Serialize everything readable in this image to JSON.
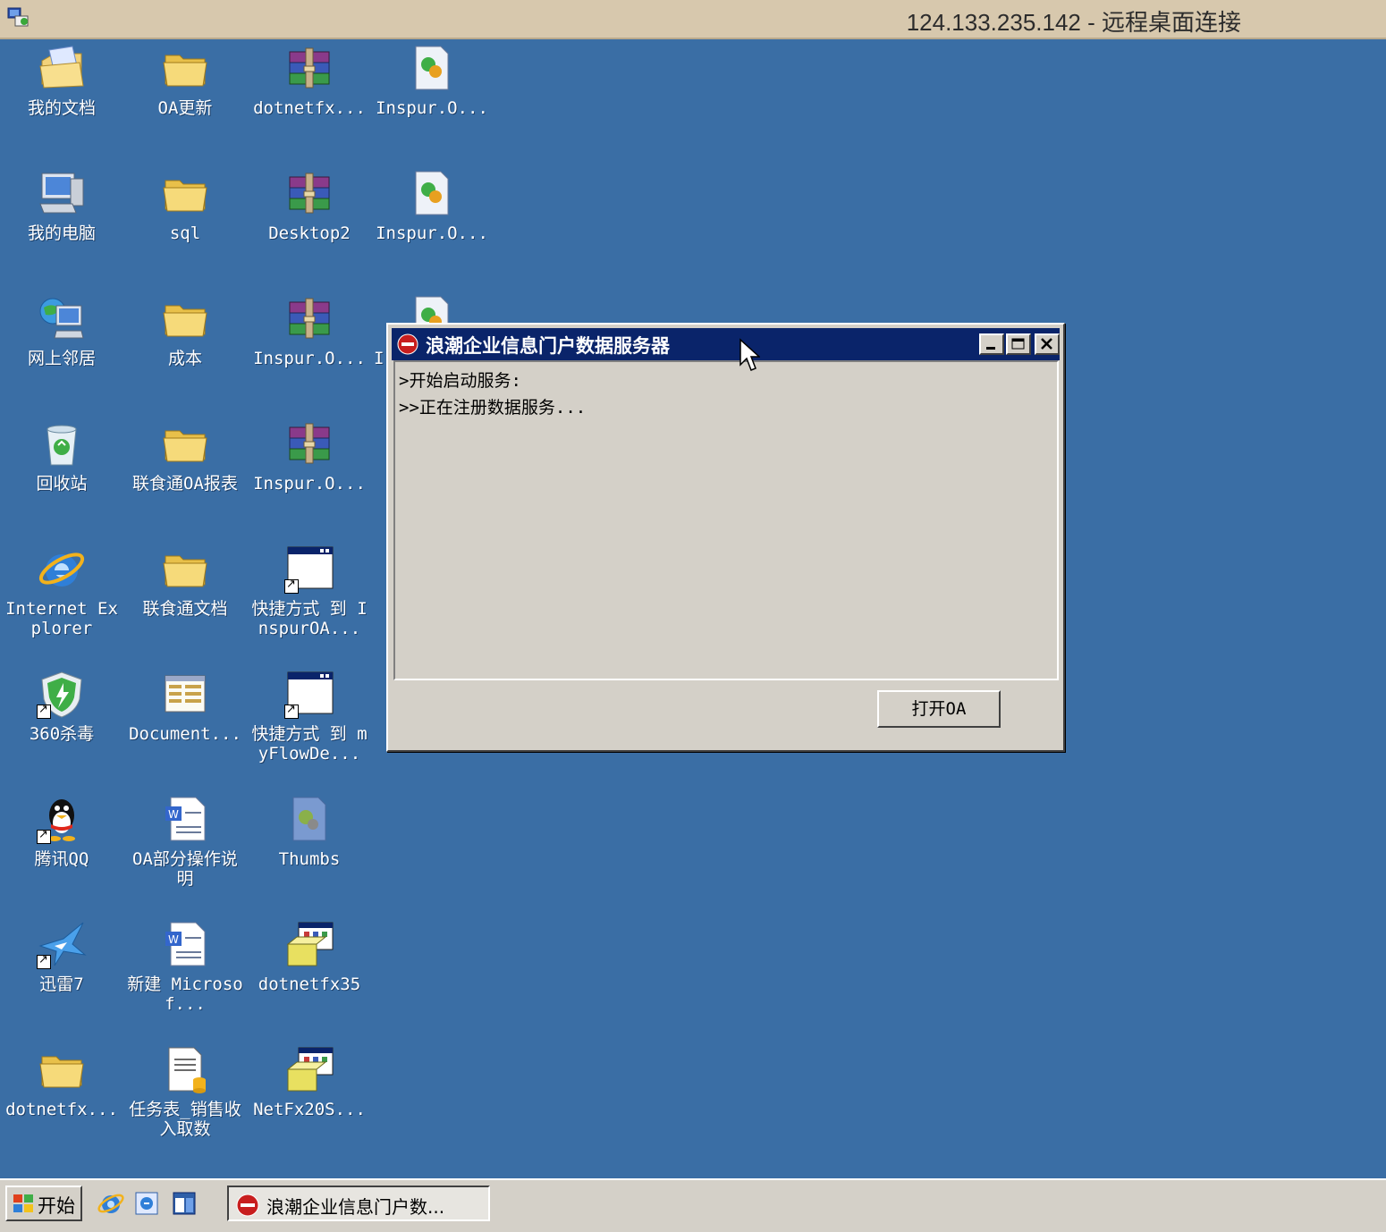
{
  "rdp": {
    "title": "124.133.235.142 - 远程桌面连接"
  },
  "desktop": {
    "icons": [
      {
        "label": "我的文档",
        "icon": "my-documents-icon"
      },
      {
        "label": "OA更新",
        "icon": "folder-icon"
      },
      {
        "label": "dotnetfx...",
        "icon": "winrar-archive-icon"
      },
      {
        "label": "Inspur.O...",
        "icon": "installer-package-icon"
      },
      {
        "label": "我的电脑",
        "icon": "my-computer-icon"
      },
      {
        "label": "sql",
        "icon": "folder-icon"
      },
      {
        "label": "Desktop2",
        "icon": "winrar-archive-icon"
      },
      {
        "label": "Inspur.O...",
        "icon": "installer-package-icon"
      },
      {
        "label": "网上邻居",
        "icon": "network-places-icon"
      },
      {
        "label": "成本",
        "icon": "folder-icon"
      },
      {
        "label": "Inspur.O...",
        "icon": "winrar-archive-icon"
      },
      {
        "label": "I",
        "icon": "installer-package-icon"
      },
      {
        "label": "回收站",
        "icon": "recycle-bin-icon"
      },
      {
        "label": "联食通OA报表",
        "icon": "folder-icon"
      },
      {
        "label": "Inspur.O...",
        "icon": "winrar-archive-icon"
      },
      {
        "label": "Internet Explorer",
        "icon": "internet-explorer-icon"
      },
      {
        "label": "联食通文档",
        "icon": "folder-icon"
      },
      {
        "label": "快捷方式 到 InspurOA...",
        "icon": "app-window-shortcut-icon"
      },
      {
        "label": "360杀毒",
        "icon": "antivirus-shield-icon"
      },
      {
        "label": "Document...",
        "icon": "document-list-icon"
      },
      {
        "label": "快捷方式 到 myFlowDe...",
        "icon": "app-window-shortcut-icon"
      },
      {
        "label": "腾讯QQ",
        "icon": "qq-penguin-icon"
      },
      {
        "label": "OA部分操作说明",
        "icon": "word-document-icon"
      },
      {
        "label": "Thumbs",
        "icon": "thumbs-db-icon"
      },
      {
        "label": "迅雷7",
        "icon": "thunder-bird-icon"
      },
      {
        "label": "新建 Microsof...",
        "icon": "word-document-icon"
      },
      {
        "label": "dotnetfx35",
        "icon": "setup-box-icon"
      },
      {
        "label": "dotnetfx...",
        "icon": "folder-icon"
      },
      {
        "label": "任务表_销售收入取数",
        "icon": "text-file-icon"
      },
      {
        "label": "NetFx20S...",
        "icon": "setup-box-icon"
      }
    ]
  },
  "window": {
    "title": "浪潮企业信息门户数据服务器",
    "log_lines": [
      ">开始启动服务:",
      ">>正在注册数据服务..."
    ],
    "open_button_label": "打开OA"
  },
  "taskbar": {
    "start_label": "开始",
    "task_label": "浪潮企业信息门户数..."
  },
  "colors": {
    "desktop_bg": "#3a6ea5",
    "titlebar": "#0a246a",
    "face": "#d4d0c8",
    "rdp_bar": "#d7c8ad"
  }
}
